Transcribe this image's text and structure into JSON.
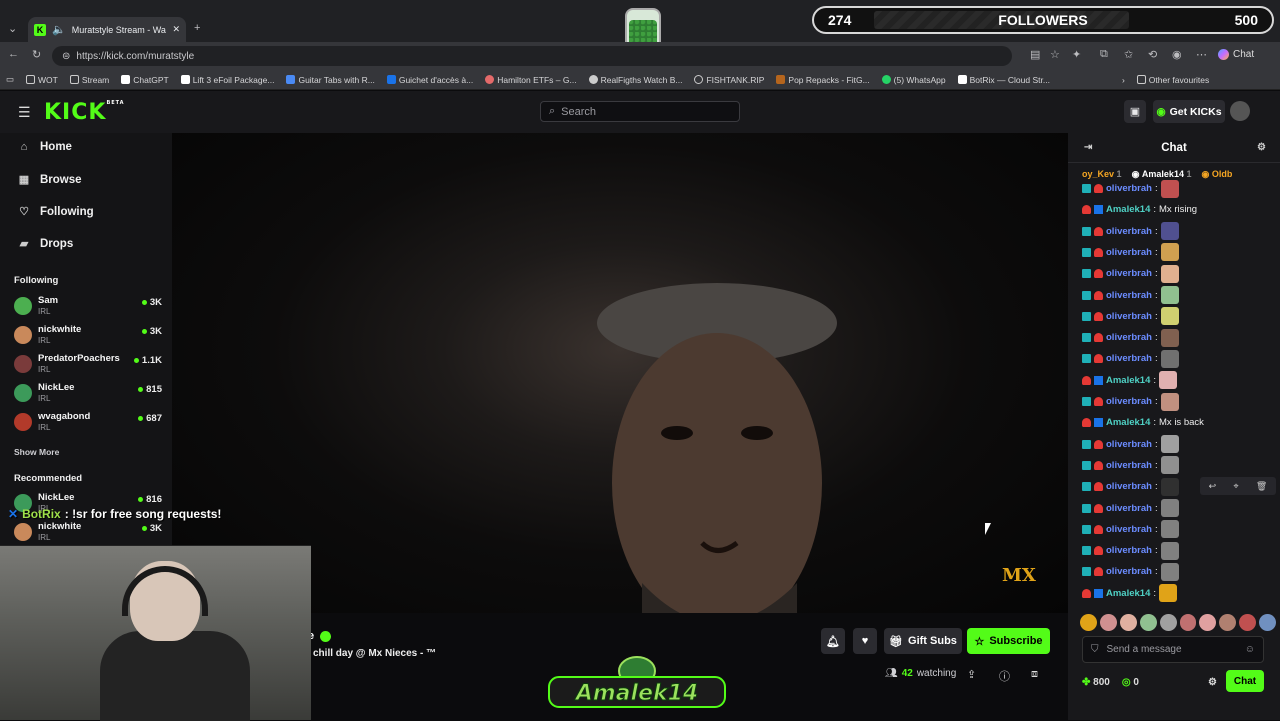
{
  "browser": {
    "tab_title": "Muratstyle Stream - Watch Li",
    "url": "https://kick.com/muratstyle",
    "copilot_label": "Chat",
    "bookmarks": [
      "WOT",
      "Stream",
      "ChatGPT",
      "Lift 3 eFoil Package...",
      "Guitar Tabs with R...",
      "Guichet d'accès à...",
      "Hamilton ETFs – G...",
      "RealFigths Watch B...",
      "FISHTANK.RIP",
      "Pop Repacks - FitG...",
      "(5) WhatsApp",
      "BotRix — Cloud Str..."
    ],
    "other_favourites": "Other favourites"
  },
  "overlay": {
    "followers_current": "274",
    "followers_label": "FOLLOWERS",
    "followers_goal": "500",
    "botrix_name": "BotRix",
    "botrix_msg": ": !sr for free song requests!",
    "mx_badge": "MX",
    "logo_text": "Amalek14"
  },
  "header": {
    "search_placeholder": "Search",
    "get_kicks": "Get KICKs"
  },
  "sidebar": {
    "nav": [
      "Home",
      "Browse",
      "Following",
      "Drops"
    ],
    "following_title": "Following",
    "following": [
      {
        "name": "Sam",
        "category": "IRL",
        "viewers": "3K",
        "color": "#4caf50"
      },
      {
        "name": "nickwhite",
        "category": "IRL",
        "viewers": "3K",
        "color": "#c9895b"
      },
      {
        "name": "PredatorPoachers",
        "category": "IRL",
        "viewers": "1.1K",
        "color": "#7a3b3b"
      },
      {
        "name": "NickLee",
        "category": "IRL",
        "viewers": "815",
        "color": "#3c9a5a"
      },
      {
        "name": "wvagabond",
        "category": "IRL",
        "viewers": "687",
        "color": "#b23a2a"
      }
    ],
    "show_more": "Show More",
    "recommended_title": "Recommended",
    "recommended": [
      {
        "name": "NickLee",
        "category": "IRL",
        "viewers": "816"
      },
      {
        "name": "nickwhite",
        "category": "IRL",
        "viewers": "3K"
      }
    ]
  },
  "stream": {
    "name_fragment": "e",
    "title": "chill day @ Mx Nieces - ™",
    "gift_subs": "Gift Subs",
    "subscribe": "Subscribe",
    "watching_count": "42",
    "watching_label": "watching"
  },
  "chat": {
    "title": "Chat",
    "gifters": [
      {
        "name": "oy_Kev",
        "count": "1",
        "color": "#f5a623"
      },
      {
        "name": "Amalek14",
        "count": "1",
        "color": "#ffffff"
      },
      {
        "name": "Oldb",
        "count": "",
        "color": "#f5a623"
      }
    ],
    "messages": [
      {
        "user": "oliverbrah",
        "type": "o",
        "text": "",
        "emote": "#c05050"
      },
      {
        "user": "Amalek14",
        "type": "a",
        "text": "Mx rising",
        "emote": ""
      },
      {
        "user": "oliverbrah",
        "type": "o",
        "text": "",
        "emote": "#505090"
      },
      {
        "user": "oliverbrah",
        "type": "o",
        "text": "",
        "emote": "#d0a050"
      },
      {
        "user": "oliverbrah",
        "type": "o",
        "text": "",
        "emote": "#e0b090"
      },
      {
        "user": "oliverbrah",
        "type": "o",
        "text": "",
        "emote": "#90c090"
      },
      {
        "user": "oliverbrah",
        "type": "o",
        "text": "",
        "emote": "#d0d070"
      },
      {
        "user": "oliverbrah",
        "type": "o",
        "text": "",
        "emote": "#806050"
      },
      {
        "user": "oliverbrah",
        "type": "o",
        "text": "",
        "emote": "#707070"
      },
      {
        "user": "Amalek14",
        "type": "a",
        "text": "",
        "emote": "#e0b0b0"
      },
      {
        "user": "oliverbrah",
        "type": "o",
        "text": "",
        "emote": "#c09080"
      },
      {
        "user": "Amalek14",
        "type": "a",
        "text": "Mx is back",
        "emote": ""
      },
      {
        "user": "oliverbrah",
        "type": "o",
        "text": "",
        "emote": "#a0a0a0"
      },
      {
        "user": "oliverbrah",
        "type": "o",
        "text": "",
        "emote": "#909090"
      },
      {
        "user": "oliverbrah",
        "type": "o",
        "text": "",
        "emote": "#303030"
      },
      {
        "user": "oliverbrah",
        "type": "o",
        "text": "",
        "emote": "#808080"
      },
      {
        "user": "oliverbrah",
        "type": "o",
        "text": "",
        "emote": "#808080"
      },
      {
        "user": "oliverbrah",
        "type": "o",
        "text": "",
        "emote": "#808080"
      },
      {
        "user": "oliverbrah",
        "type": "o",
        "text": "",
        "emote": "#808080"
      },
      {
        "user": "Amalek14",
        "type": "a",
        "text": "",
        "emote": "#e0a318"
      }
    ],
    "input_placeholder": "Send a message",
    "points": "800",
    "kicks": "0",
    "send": "Chat"
  },
  "colors": {
    "accent": "#53fc18"
  }
}
